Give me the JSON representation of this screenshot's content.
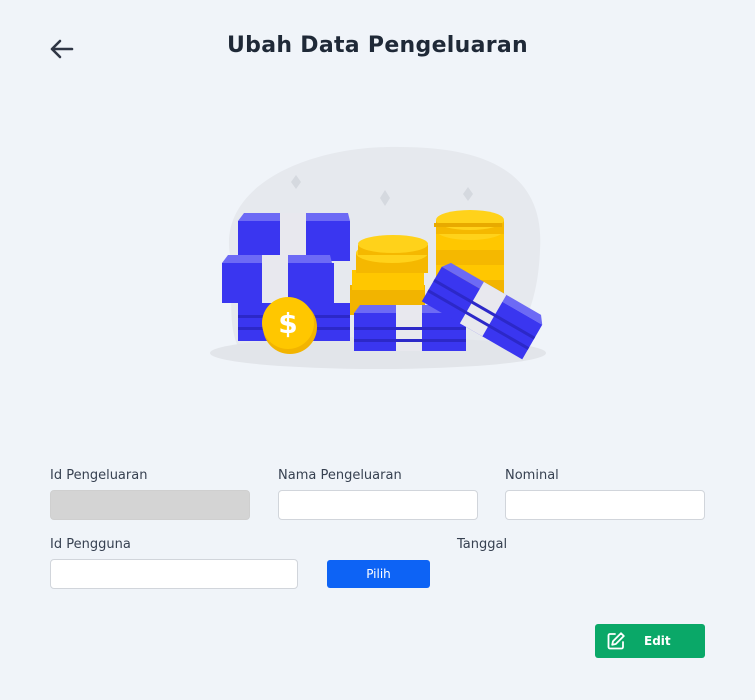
{
  "header": {
    "title": "Ubah Data Pengeluaran",
    "back_icon": "arrow-left-icon"
  },
  "illustration": {
    "description_icon": "money-stack-illustration",
    "colors": {
      "bills": "#3a36f0",
      "coins": "#ffc700",
      "blob": "#e6e9ee"
    }
  },
  "form": {
    "id_pengeluaran": {
      "label": "Id Pengeluaran",
      "value": ""
    },
    "nama_pengeluaran": {
      "label": "Nama Pengeluaran",
      "value": ""
    },
    "nominal": {
      "label": "Nominal",
      "value": ""
    },
    "id_pengguna": {
      "label": "Id Pengguna",
      "value": ""
    },
    "pilih_label": "Pilih",
    "tanggal": {
      "label": "Tanggal"
    }
  },
  "actions": {
    "edit_label": "Edit",
    "edit_icon": "edit-icon"
  },
  "colors": {
    "background": "#f0f4f9",
    "primary": "#0d63f5",
    "success": "#0aa868",
    "disabled": "#d4d4d4"
  }
}
